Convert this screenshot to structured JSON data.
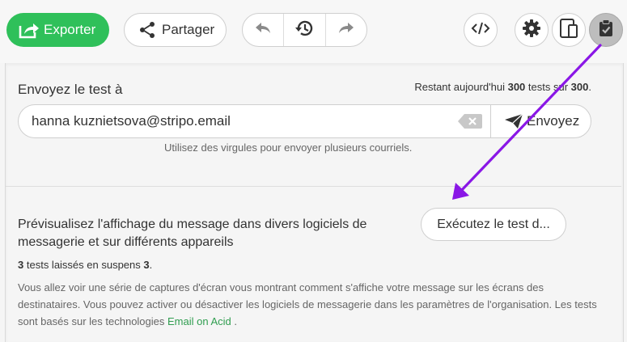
{
  "toolbar": {
    "export_label": "Exporter",
    "share_label": "Partager",
    "icons": {
      "export": "export-icon",
      "share": "share-icon",
      "undo": "undo-icon",
      "history": "history-icon",
      "redo": "redo-icon",
      "code": "code-icon",
      "settings": "gear-icon",
      "devices": "devices-icon",
      "test": "clipboard-check-icon"
    },
    "active_tool": "test"
  },
  "send_test": {
    "label": "Envoyez le test à",
    "remaining_prefix": "Restant aujourd'hui",
    "remaining_count": "300",
    "remaining_mid": "tests sur",
    "remaining_total": "300",
    "remaining_suffix": ".",
    "email_value": "hanna kuznietsova@stripo.email",
    "send_label": "Envoyez",
    "hint": "Utilisez des virgules pour envoyer plusieurs courriels."
  },
  "preview": {
    "title": "Prévisualisez l'affichage du message dans divers logiciels de messagerie et sur différents appareils",
    "run_label": "Exécutez le test d...",
    "pending_count": "3",
    "pending_text": "tests laissés en suspens",
    "pending_total": "3",
    "pending_suffix": ".",
    "description": "Vous allez voir une série de captures d'écran vous montrant comment s'affiche votre message sur les écrans des destinataires. Vous pouvez activer ou désactiver les logiciels de messagerie dans les paramètres de l'organisation. Les tests sont basés sur les technologies",
    "link_label": "Email on Acid",
    "description_end": "."
  },
  "colors": {
    "brand_green": "#2fc05a",
    "link_green": "#2f9d4f",
    "annotation_purple": "#8a17e6"
  }
}
